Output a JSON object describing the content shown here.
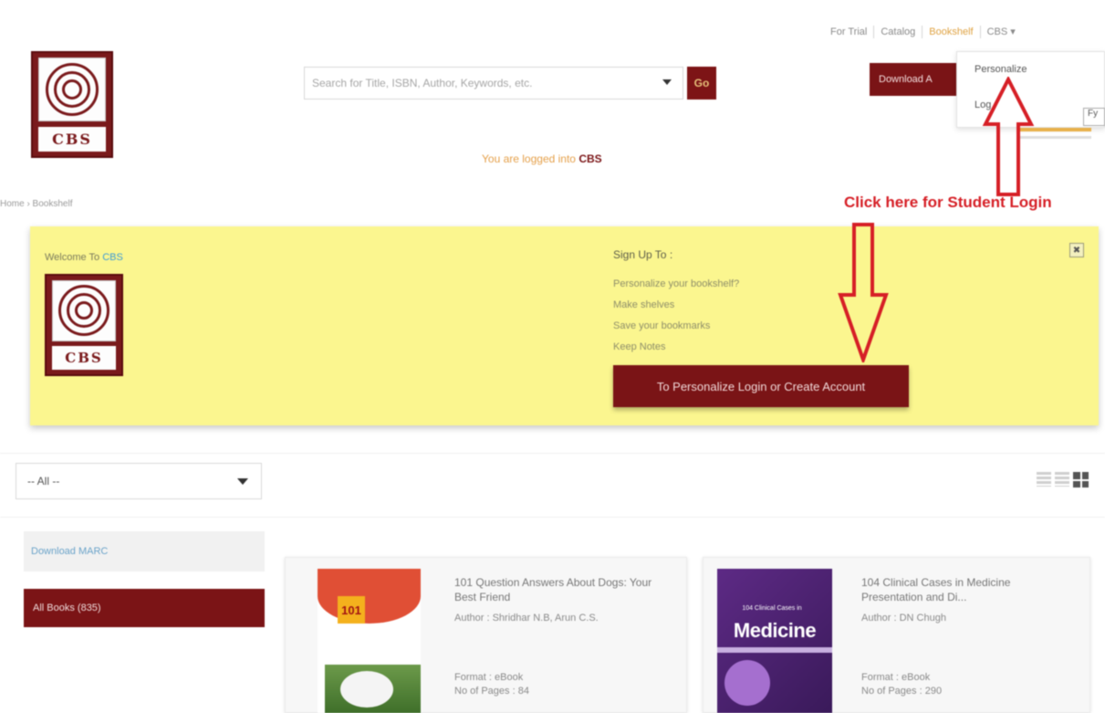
{
  "brand": {
    "logo_text": "CBS",
    "accent": "#7a1416",
    "highlight": "#fbf68f",
    "annotation_color": "#d61f26"
  },
  "topnav": {
    "items": [
      "For Trial",
      "Catalog",
      "Bookshelf",
      "CBS"
    ],
    "active_index": 2
  },
  "search": {
    "placeholder": "Search for Title, ISBN, Author, Keywords, etc.",
    "go_label": "Go"
  },
  "download_app_label": "Download A",
  "user_menu": {
    "items": [
      "Personalize",
      "Log"
    ],
    "tag": "Fy"
  },
  "logged_in": {
    "prefix": "You are logged into",
    "name": "CBS"
  },
  "breadcrumb": "Home › Bookshelf",
  "annotation": {
    "label": "Click here for Student Login"
  },
  "welcome": {
    "title_prefix": "Welcome To",
    "title_name": "CBS",
    "signup_title": "Sign Up To :",
    "signup_items": [
      "Personalize your bookshelf?",
      "Make shelves",
      "Save your bookmarks",
      "Keep Notes"
    ],
    "close_label": "✖",
    "cta_label": "To Personalize Login or Create Account"
  },
  "filter": {
    "selected": "-- All --"
  },
  "sidebar": {
    "download_marc": "Download MARC",
    "all_books": "All Books (835)"
  },
  "books": [
    {
      "title": "101 Question Answers About Dogs: Your Best Friend",
      "author": "Author : Shridhar N.B, Arun C.S.",
      "format": "Format : eBook",
      "pages": "No of Pages : 84",
      "cover_num": "101"
    },
    {
      "title": "104 Clinical Cases in Medicine Presentation and Di...",
      "author": "Author : DN Chugh",
      "format": "Format : eBook",
      "pages": "No of Pages : 290",
      "cover_small": "104 Clinical Cases in",
      "cover_big": "Medicine"
    }
  ]
}
